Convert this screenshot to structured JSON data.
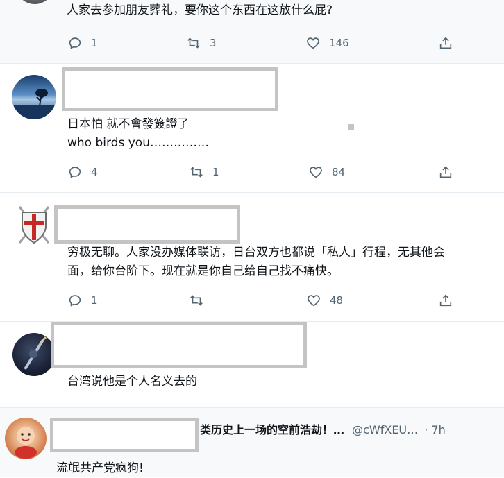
{
  "tweets": [
    {
      "text": "人家去参加朋友葬礼，要你这个东西在这放什么屁?",
      "replies": "1",
      "retweets": "3",
      "likes": "146"
    },
    {
      "lines": [
        "日本怕 就不會發簽證了",
        "who birds you……………"
      ],
      "replies": "4",
      "retweets": "1",
      "likes": "84"
    },
    {
      "lines": [
        "穷极无聊。人家没办媒体联访，日台双方也都说「私人」行程，无其他会",
        "面，给你台阶下。现在就是你自己给自己找不痛快。"
      ],
      "replies": "1",
      "retweets": "",
      "likes": "48"
    },
    {
      "text": "台湾说他是个人名义去的"
    },
    {
      "header_name": "类历史上一场的空前浩劫！…",
      "handle": "@cWfXEU…",
      "time": "· 7h",
      "text": "流氓共产党疯狗!"
    }
  ]
}
